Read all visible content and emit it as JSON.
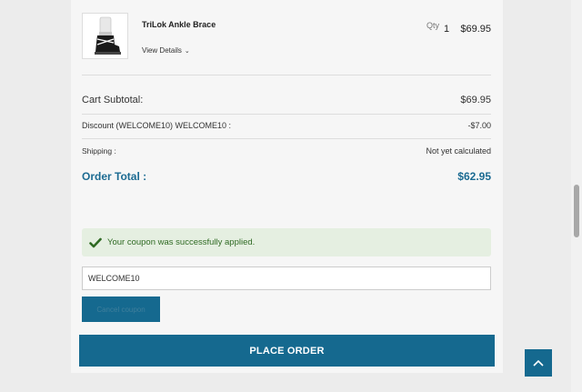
{
  "cart": {
    "product": {
      "name": "TriLok Ankle Brace",
      "view_details_label": "View Details",
      "qty_label": "Qty",
      "qty": "1",
      "price": "$69.95",
      "thumbnail_icon": "ankle-brace-image"
    },
    "summary": {
      "subtotal_label": "Cart Subtotal:",
      "subtotal_value": "$69.95",
      "discount_label": "Discount (WELCOME10) WELCOME10 :",
      "discount_value": "-$7.00",
      "shipping_label": "Shipping :",
      "shipping_value": "Not yet calculated",
      "total_label": "Order Total :",
      "total_value": "$62.95"
    },
    "coupon": {
      "success_message": "Your coupon was successfully applied.",
      "code_value": "WELCOME10",
      "cancel_label": "Cancel coupon"
    },
    "place_order_label": "PLACE ORDER"
  },
  "colors": {
    "accent": "#15698f",
    "total_text": "#1c6b92",
    "success_bg": "#e5efe1",
    "success_text": "#2f6a23"
  },
  "icons": {
    "check": "checkmark-icon",
    "chevron": "chevron-down-icon",
    "scroll_top": "arrow-up-icon"
  }
}
